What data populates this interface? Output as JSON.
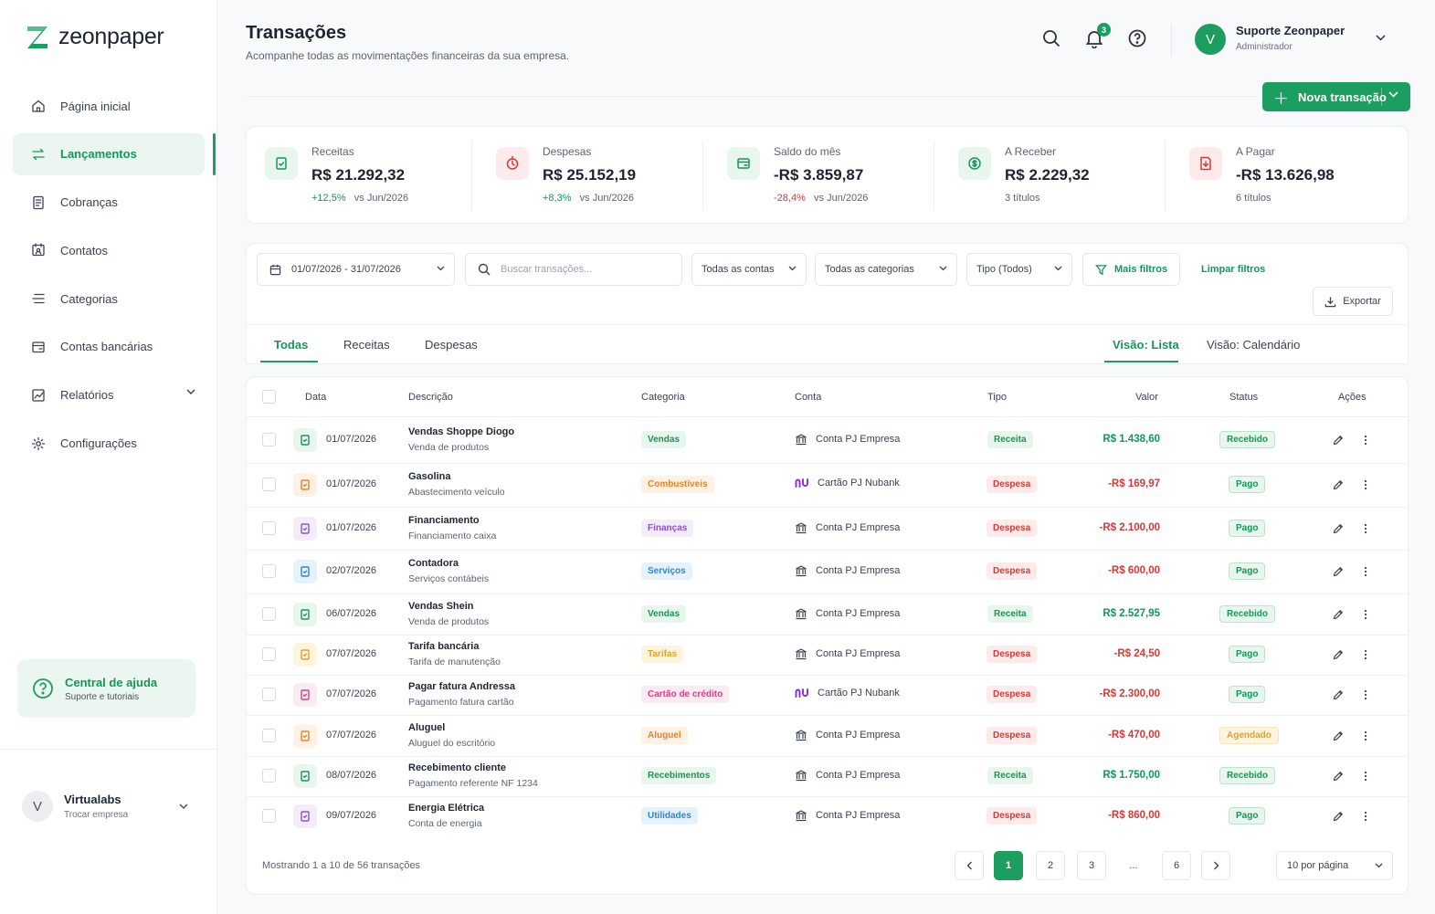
{
  "brand": {
    "name": "zeonpaper",
    "accent": "#1b9e5f"
  },
  "sidebar": {
    "items": [
      {
        "label": "Página inicial",
        "icon": "home-icon"
      },
      {
        "label": "Lançamentos",
        "icon": "transfer-icon",
        "active": true
      },
      {
        "label": "Cobranças",
        "icon": "document-icon"
      },
      {
        "label": "Contatos",
        "icon": "contacts-icon"
      },
      {
        "label": "Categorias",
        "icon": "list-icon"
      },
      {
        "label": "Contas bancárias",
        "icon": "wallet-icon"
      },
      {
        "label": "Relatórios",
        "icon": "chart-icon",
        "expandable": true
      },
      {
        "label": "Configurações",
        "icon": "gear-icon"
      }
    ],
    "help": {
      "title": "Central de ajuda",
      "subtitle": "Suporte e tutoriais"
    },
    "company": {
      "initial": "V",
      "name": "Virtualabs",
      "action": "Trocar empresa"
    }
  },
  "header": {
    "title": "Transações",
    "subtitle": "Acompanhe todas as movimentações financeiras da sua empresa.",
    "notifications_count": "3",
    "user": {
      "initial": "V",
      "name": "Suporte Zeonpaper",
      "role": "Administrador"
    },
    "new_button": "Nova transação"
  },
  "stats": [
    {
      "label": "Receitas",
      "value": "R$ 21.292,32",
      "delta": "+12,5%",
      "delta_type": "pos",
      "compare": "vs Jun/2026",
      "icon": "receipt-icon",
      "tone": "green"
    },
    {
      "label": "Despesas",
      "value": "R$ 25.152,19",
      "delta": "+8,3%",
      "delta_type": "pos",
      "compare": "vs Jun/2026",
      "icon": "clock-arrow-icon",
      "tone": "red"
    },
    {
      "label": "Saldo do mês",
      "value": "-R$ 3.859,87",
      "delta": "-28,4%",
      "delta_type": "neg",
      "compare": "vs Jun/2026",
      "icon": "wallet-icon",
      "tone": "green"
    },
    {
      "label": "A Receber",
      "value": "R$ 2.229,32",
      "delta": "",
      "delta_type": "",
      "compare": "3 títulos",
      "icon": "dollar-circle-icon",
      "tone": "green"
    },
    {
      "label": "A Pagar",
      "value": "-R$ 13.626,98",
      "delta": "",
      "delta_type": "",
      "compare": "6 títulos",
      "icon": "bill-icon",
      "tone": "red"
    }
  ],
  "filters": {
    "date_range": "01/07/2026 - 31/07/2026",
    "search_placeholder": "Buscar transações...",
    "accounts": "Todas as contas",
    "categories": "Todas as categorias",
    "type": "Tipo (Todos)",
    "more": "Mais filtros",
    "clear": "Limpar filtros",
    "export": "Exportar"
  },
  "tabs": [
    "Todas",
    "Receitas",
    "Despesas"
  ],
  "views": [
    "Visão: Lista",
    "Visão: Calendário"
  ],
  "table": {
    "columns": [
      "Data",
      "Descrição",
      "Categoria",
      "Conta",
      "Tipo",
      "Valor",
      "Status",
      "Ações"
    ],
    "rows": [
      {
        "date": "01/07/2026",
        "title": "Vendas Shoppe Diogo",
        "subtitle": "Venda de produtos",
        "category": "Vendas",
        "cat_tone": "green",
        "account": "Conta PJ Empresa",
        "bank": "bank",
        "type": "Receita",
        "value": "R$ 1.438,60",
        "status": "Recebido",
        "icon_tone": "green"
      },
      {
        "date": "01/07/2026",
        "title": "Gasolina",
        "subtitle": "Abastecimento veículo",
        "category": "Combustíveis",
        "cat_tone": "orange",
        "account": "Cartão PJ Nubank",
        "bank": "nu",
        "type": "Despesa",
        "value": "-R$ 169,97",
        "status": "Pago",
        "icon_tone": "orange"
      },
      {
        "date": "01/07/2026",
        "title": "Financiamento",
        "subtitle": "Financiamento caixa",
        "category": "Finanças",
        "cat_tone": "purple",
        "account": "Conta PJ Empresa",
        "bank": "bank",
        "type": "Despesa",
        "value": "-R$ 2.100,00",
        "status": "Pago",
        "icon_tone": "purple"
      },
      {
        "date": "02/07/2026",
        "title": "Contadora",
        "subtitle": "Serviços contábeis",
        "category": "Serviços",
        "cat_tone": "blue",
        "account": "Conta PJ Empresa",
        "bank": "bank",
        "type": "Despesa",
        "value": "-R$ 600,00",
        "status": "Pago",
        "icon_tone": "blue"
      },
      {
        "date": "06/07/2026",
        "title": "Vendas Shein",
        "subtitle": "Venda de produtos",
        "category": "Vendas",
        "cat_tone": "green",
        "account": "Conta PJ Empresa",
        "bank": "bank",
        "type": "Receita",
        "value": "R$ 2.527,95",
        "status": "Recebido",
        "icon_tone": "green"
      },
      {
        "date": "07/07/2026",
        "title": "Tarifa bancária",
        "subtitle": "Tarifa de manutenção",
        "category": "Tarifas",
        "cat_tone": "yellow",
        "account": "Conta PJ Empresa",
        "bank": "bank",
        "type": "Despesa",
        "value": "-R$ 24,50",
        "status": "Pago",
        "icon_tone": "yellow"
      },
      {
        "date": "07/07/2026",
        "title": "Pagar fatura Andressa",
        "subtitle": "Pagamento fatura cartão",
        "category": "Cartão de crédito",
        "cat_tone": "pink",
        "account": "Cartão PJ Nubank",
        "bank": "nu",
        "type": "Despesa",
        "value": "-R$ 2.300,00",
        "status": "Pago",
        "icon_tone": "pink"
      },
      {
        "date": "07/07/2026",
        "title": "Aluguel",
        "subtitle": "Aluguel do escritório",
        "category": "Aluguel",
        "cat_tone": "orange",
        "account": "Conta PJ Empresa",
        "bank": "bank",
        "type": "Despesa",
        "value": "-R$ 470,00",
        "status": "Agendado",
        "icon_tone": "orange"
      },
      {
        "date": "08/07/2026",
        "title": "Recebimento cliente",
        "subtitle": "Pagamento referente NF 1234",
        "category": "Recebimentos",
        "cat_tone": "green",
        "account": "Conta PJ Empresa",
        "bank": "bank",
        "type": "Receita",
        "value": "R$ 1.750,00",
        "status": "Recebido",
        "icon_tone": "green"
      },
      {
        "date": "09/07/2026",
        "title": "Energia Elétrica",
        "subtitle": "Conta de energia",
        "category": "Utilidades",
        "cat_tone": "blue",
        "account": "Conta PJ Empresa",
        "bank": "bank",
        "type": "Despesa",
        "value": "-R$ 860,00",
        "status": "Pago",
        "icon_tone": "purple"
      }
    ]
  },
  "pagination": {
    "summary": "Mostrando 1 a 10 de 56 transações",
    "pages": [
      "1",
      "2",
      "3",
      "...",
      "6"
    ],
    "per_page": "10 por página"
  },
  "colors": {
    "green_bg": "#e8f6ee",
    "green_fg": "#16955a",
    "red_bg": "#fdeaea",
    "red_fg": "#d33a3a",
    "orange_bg": "#fff1e3",
    "orange_fg": "#e5842a",
    "purple_bg": "#f3ecfb",
    "purple_fg": "#8e4fd1",
    "blue_bg": "#e6f2fb",
    "blue_fg": "#2f86c8",
    "yellow_bg": "#fff5df",
    "yellow_fg": "#e0a226",
    "pink_bg": "#fdebf3",
    "pink_fg": "#d9417f",
    "nubank": "#8a2be2"
  }
}
